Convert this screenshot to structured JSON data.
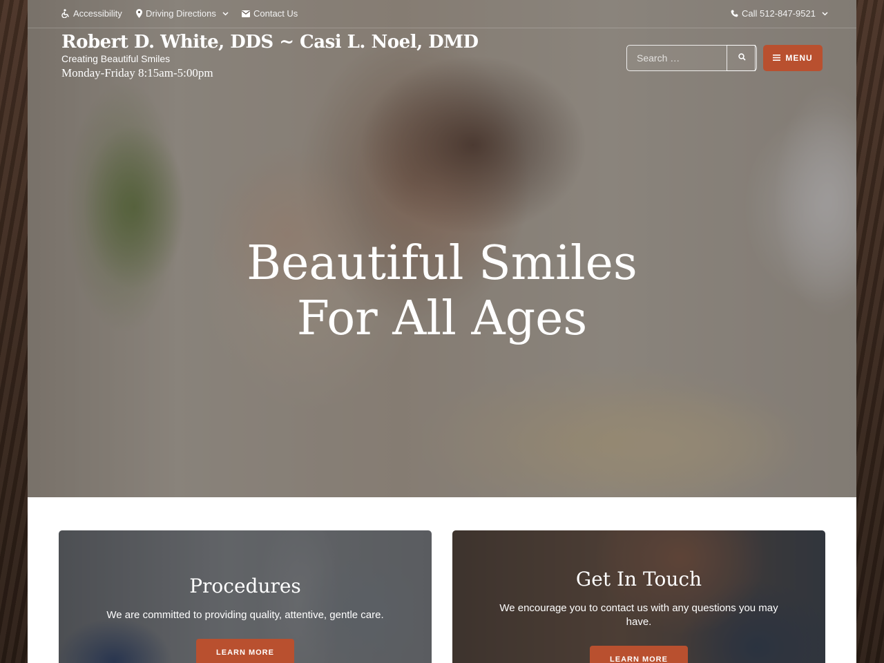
{
  "utility": {
    "accessibility": "Accessibility",
    "directions": "Driving Directions",
    "contact": "Contact Us",
    "phone": "Call 512-847-9521"
  },
  "brand": {
    "title": "Robert D. White, DDS ~ Casi L. Noel, DMD",
    "tagline": "Creating Beautiful Smiles",
    "hours": "Monday-Friday 8:15am-5:00pm"
  },
  "search": {
    "placeholder": "Search …"
  },
  "menu": {
    "label": "MENU"
  },
  "hero": {
    "line1": "Beautiful Smiles",
    "line2": "For All Ages"
  },
  "cards": [
    {
      "title": "Procedures",
      "text": "We are committed to providing quality, attentive, gentle care.",
      "button": "LEARN MORE"
    },
    {
      "title": "Get In Touch",
      "text": "We encourage you to contact us with any questions you may have.",
      "button": "LEARN MORE"
    }
  ],
  "colors": {
    "accent": "#b9502f"
  },
  "icons": {
    "accessibility": "wheelchair-icon",
    "directions": "map-marker-icon",
    "contact": "envelope-icon",
    "phone": "phone-icon",
    "search": "search-icon",
    "menu": "hamburger-icon",
    "dropdown": "chevron-down-icon"
  }
}
